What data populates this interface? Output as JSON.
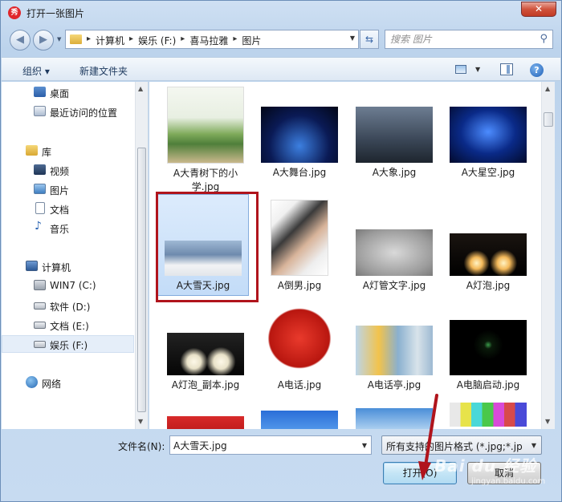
{
  "window": {
    "title": "打开一张图片",
    "close_label": "✕",
    "app_icon_text": "秀"
  },
  "address": {
    "crumbs": [
      "计算机",
      "娱乐 (F:)",
      "喜马拉雅",
      "图片"
    ]
  },
  "search": {
    "placeholder": "搜索 图片"
  },
  "toolbar": {
    "organize_label": "组织 ▾",
    "new_folder_label": "新建文件夹",
    "help_label": "?"
  },
  "nav": {
    "items": [
      {
        "label": "桌面"
      },
      {
        "label": "最近访问的位置"
      },
      {
        "label": "库"
      },
      {
        "label": "视频"
      },
      {
        "label": "图片"
      },
      {
        "label": "文档"
      },
      {
        "label": "音乐"
      },
      {
        "label": "计算机"
      },
      {
        "label": "WIN7 (C:)"
      },
      {
        "label": "软件 (D:)"
      },
      {
        "label": "文档 (E:)"
      },
      {
        "label": "娱乐 (F:)"
      },
      {
        "label": "网络"
      }
    ]
  },
  "files": [
    {
      "name": "A大青树下的小学.jpg",
      "name_line1": "A大青树下的小",
      "name_line2": "学.jpg"
    },
    {
      "name": "A大舞台.jpg"
    },
    {
      "name": "A大象.jpg"
    },
    {
      "name": "A大星空.jpg"
    },
    {
      "name": "A大雪天.jpg"
    },
    {
      "name": "A倒男.jpg"
    },
    {
      "name": "A灯管文字.jpg"
    },
    {
      "name": "A灯泡.jpg"
    },
    {
      "name": "A灯泡_副本.jpg"
    },
    {
      "name": "A电话.jpg"
    },
    {
      "name": "A电话亭.jpg"
    },
    {
      "name": "A电脑启动.jpg"
    }
  ],
  "selected_file": "A大雪天.jpg",
  "bottom": {
    "filename_label": "文件名(N):",
    "filename_value": "A大雪天.jpg",
    "filter_value": "所有支持的图片格式 (*.jpg;*.jp",
    "open_label": "打开(O)",
    "cancel_label": "取消"
  },
  "watermark": {
    "main": "Bai du 经验",
    "sub": "jingyan.baidu.com"
  },
  "colors": {
    "highlight_box": "#b0141c",
    "selection": "#c3dcf8",
    "annotation_arrow": "#b0141c"
  }
}
